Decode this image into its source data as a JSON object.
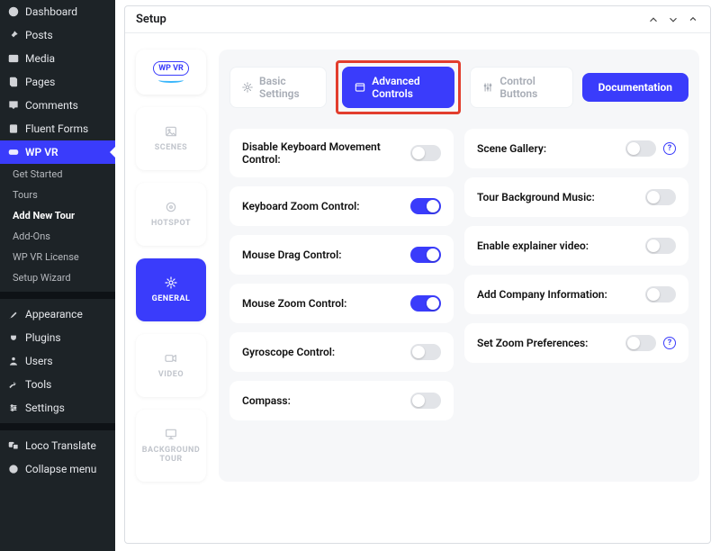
{
  "wp_sidebar": {
    "items": [
      {
        "label": "Dashboard",
        "icon": "dashboard-icon"
      },
      {
        "label": "Posts",
        "icon": "pin-icon"
      },
      {
        "label": "Media",
        "icon": "media-icon"
      },
      {
        "label": "Pages",
        "icon": "page-icon"
      },
      {
        "label": "Comments",
        "icon": "comment-icon"
      },
      {
        "label": "Fluent Forms",
        "icon": "form-icon"
      },
      {
        "label": "WP VR",
        "icon": "wpvr-icon",
        "active": true,
        "submenu": [
          "Get Started",
          "Tours",
          "Add New Tour",
          "Add-Ons",
          "WP VR License",
          "Setup Wizard"
        ],
        "submenu_current": "Add New Tour"
      },
      {
        "sep": true
      },
      {
        "label": "Appearance",
        "icon": "brush-icon"
      },
      {
        "label": "Plugins",
        "icon": "plugin-icon"
      },
      {
        "label": "Users",
        "icon": "user-icon"
      },
      {
        "label": "Tools",
        "icon": "tools-icon"
      },
      {
        "label": "Settings",
        "icon": "settings-icon"
      },
      {
        "sep": true
      },
      {
        "label": "Loco Translate",
        "icon": "translate-icon"
      },
      {
        "label": "Collapse menu",
        "icon": "collapse-icon"
      }
    ]
  },
  "panel": {
    "title": "Setup"
  },
  "vtabs": [
    {
      "label": "SCENES",
      "icon": "image-icon"
    },
    {
      "label": "HOTSPOT",
      "icon": "target-icon"
    },
    {
      "label": "GENERAL",
      "icon": "gear-icon",
      "active": true
    },
    {
      "label": "VIDEO",
      "icon": "video-icon"
    },
    {
      "label": "BACKGROUND TOUR",
      "icon": "monitor-icon"
    }
  ],
  "htabs": [
    {
      "label": "Basic Settings",
      "icon": "gear-icon"
    },
    {
      "label": "Advanced Controls",
      "icon": "panel-icon",
      "active": true
    },
    {
      "label": "Control Buttons",
      "icon": "sliders-icon"
    }
  ],
  "doc_button": "Documentation",
  "left_col": [
    {
      "label": "Disable Keyboard Movement Control:",
      "on": false
    },
    {
      "label": "Keyboard Zoom Control:",
      "on": true
    },
    {
      "label": "Mouse Drag Control:",
      "on": true
    },
    {
      "label": "Mouse Zoom Control:",
      "on": true
    },
    {
      "label": "Gyroscope Control:",
      "on": false
    },
    {
      "label": "Compass:",
      "on": false
    }
  ],
  "right_col": [
    {
      "label": "Scene Gallery:",
      "on": false,
      "info": true
    },
    {
      "label": "Tour Background Music:",
      "on": false
    },
    {
      "label": "Enable explainer video:",
      "on": false
    },
    {
      "label": "Add Company Information:",
      "on": false
    },
    {
      "label": "Set Zoom Preferences:",
      "on": false,
      "info": true
    }
  ],
  "logo_text": "WP VR"
}
